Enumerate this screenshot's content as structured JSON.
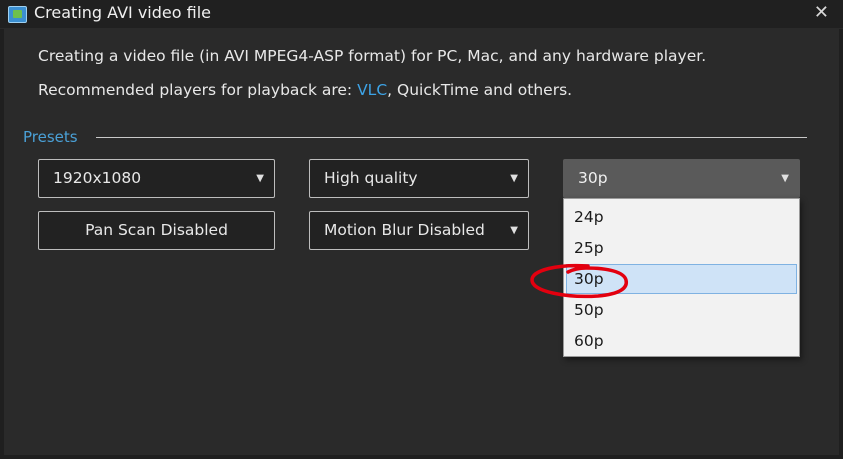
{
  "window": {
    "title": "Creating AVI video file",
    "close_glyph": "✕"
  },
  "intro": {
    "line1": "Creating a video file (in AVI MPEG4-ASP format) for PC, Mac, and any hardware player.",
    "line2_prefix": "Recommended players for playback are: ",
    "line2_link": "VLC",
    "line2_suffix": ", QuickTime and others."
  },
  "presets": {
    "label": "Presets",
    "resolution": {
      "value": "1920x1080",
      "arrow": "▼"
    },
    "quality": {
      "value": "High quality",
      "arrow": "▼"
    },
    "framerate": {
      "value": "30p",
      "arrow": "▼",
      "options": [
        "24p",
        "25p",
        "30p",
        "50p",
        "60p"
      ],
      "selected_index": 2
    },
    "pan_scan_button": "Pan  Scan Disabled",
    "motion_blur": {
      "value": "Motion Blur Disabled",
      "arrow": "▼"
    }
  },
  "colors": {
    "background": "#2a2a2a",
    "accent": "#4aa0d6",
    "link": "#3da3e6",
    "selection": "#cfe3f7",
    "annotation": "#e3000f"
  }
}
